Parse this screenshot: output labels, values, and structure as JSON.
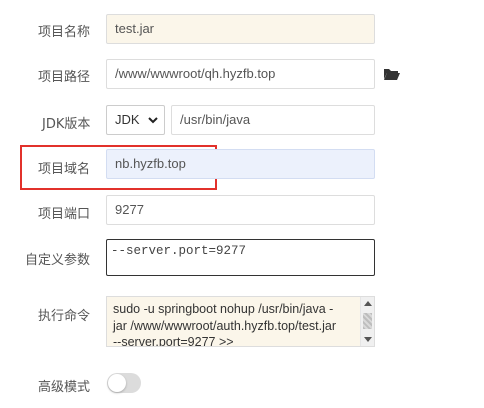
{
  "form": {
    "project_name": {
      "label": "项目名称",
      "value": "test.jar"
    },
    "project_path": {
      "label": "项目路径",
      "value": "/www/wwwroot/qh.hyzfb.top",
      "icon": "folder-open-icon"
    },
    "jdk": {
      "label": "JDK版本",
      "selected": "JDK",
      "path": "/usr/bin/java"
    },
    "domain": {
      "label": "项目域名",
      "value": "nb.hyzfb.top"
    },
    "port": {
      "label": "项目端口",
      "value": "9277"
    },
    "custom_params": {
      "label": "自定义参数",
      "value": "--server.port=9277"
    },
    "exec_command": {
      "label": "执行命令",
      "lines": [
        "sudo -u springboot nohup /usr/bin/java -",
        "jar  /www/wwwroot/auth.hyzfb.top/test.jar",
        "--server.port=9277 >>"
      ]
    },
    "advanced_mode": {
      "label": "高级模式",
      "enabled": false
    }
  },
  "colors": {
    "highlight_box": "#e2312b",
    "domain_field_bg": "#ecf1fc",
    "readonly_bg": "#fbf6ea"
  }
}
